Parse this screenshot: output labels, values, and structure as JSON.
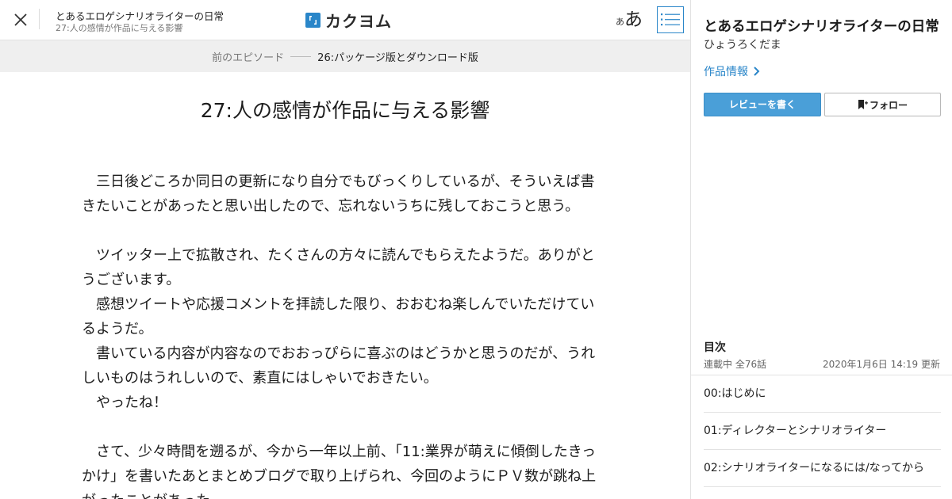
{
  "header": {
    "work_title": "とあるエロゲシナリオライターの日常",
    "episode_subtitle": "27:人の感情が作品に与える影響",
    "logo_text": "カクヨム",
    "font_small": "あ",
    "font_big": "あ",
    "accent_color": "#2a86c9"
  },
  "prev_episode": {
    "label": "前のエピソード",
    "title": "26:パッケージ版とダウンロード版"
  },
  "episode": {
    "title": "27:人の感情が作品に与える影響",
    "lines": [
      "　三日後どころか同日の更新になり自分でもびっくりしているが、そういえば書",
      "きたいことがあったと思い出したので、忘れないうちに残しておこうと思う。",
      "",
      "　ツイッター上で拡散され、たくさんの方々に読んでもらえたようだ。ありがと",
      "うございます。",
      "　感想ツイートや応援コメントを拝読した限り、おおむね楽しんでいただけてい",
      "るようだ。",
      "　書いている内容が内容なのでおおっぴらに喜ぶのはどうかと思うのだが、うれ",
      "しいものはうれしいので、素直にはしゃいでおきたい。",
      "　やったね！",
      "",
      "　さて、少々時間を遡るが、今から一年以上前、「11:業界が萌えに傾倒したきっ",
      "かけ」を書いたあとまとめブログで取り上げられ、今回のようにＰＶ数が跳ね上",
      "がったことがあった。"
    ]
  },
  "sidebar": {
    "title": "とあるエロゲシナリオライターの日常",
    "author": "ひょうろくだま",
    "info_link": "作品情報",
    "review_button": "レビューを書く",
    "follow_button": "フォロー",
    "toc_heading": "目次",
    "toc_status": "連載中 全76話",
    "toc_updated": "2020年1月6日 14:19 更新",
    "toc_items": [
      "00:はじめに",
      "01:ディレクターとシナリオライター",
      "02:シナリオライターになるには/なってから"
    ]
  }
}
